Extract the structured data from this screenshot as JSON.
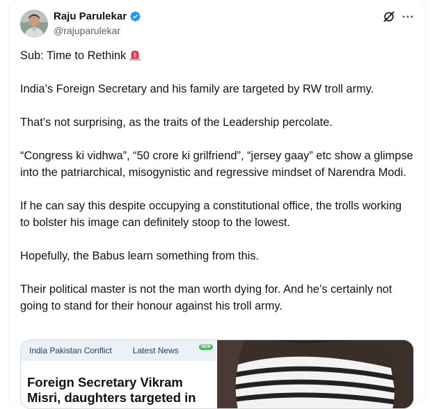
{
  "author": {
    "name": "Raju Parulekar",
    "handle": "@rajuparulekar",
    "verified": true,
    "avatar_icon": "person-avatar"
  },
  "actions": {
    "grok_icon": "grok-icon",
    "more_icon": "more-options-icon"
  },
  "tweet": {
    "subject": "Sub: Time to Rethink",
    "subject_emoji": "police-siren-emoji",
    "paragraphs": [
      "India’s Foreign Secretary and his family are targeted by RW troll army.",
      "That’s not surprising, as the traits of the Leadership percolate.",
      "“Congress ki vidhwa”, “50 crore ki grilfriend”, “jersey gaay” etc show a glimpse into the patriarchical, misogynistic and regressive mindset of Narendra Modi.",
      "If he can say this despite occupying a constitutional office, the trolls working to bolster his image can definitely stoop to the lowest.",
      "Hopefully, the Babus learn something from this.",
      "Their political master is not the man worth dying for. And he’s certainly not going to stand for their honour against his troll army."
    ]
  },
  "media": {
    "news_tag_1": "India Pakistan Conflict",
    "news_tag_2": "Latest News",
    "news_badge": "NEW",
    "headline": "Foreign Secretary Vikram Misri, daughters targeted in"
  },
  "colors": {
    "verified_blue": "#1d9bf0",
    "text_primary": "#0f1419",
    "text_secondary": "#536471",
    "border": "#cfd9de"
  }
}
